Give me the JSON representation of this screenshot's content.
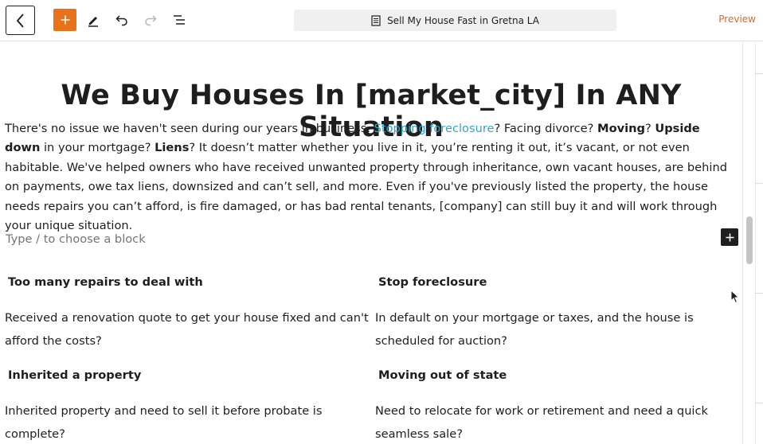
{
  "toolbar": {
    "document_title": "Sell My House Fast in Gretna LA",
    "preview_label": "Preview"
  },
  "content": {
    "heading": "We Buy Houses In [market_city] In ANY Situation",
    "intro": {
      "part1": "There's no issue we haven't seen during our years in business. ",
      "link": "Stopping foreclosure",
      "part2": "? Facing divorce? ",
      "bold1": "Moving",
      "part3": "? ",
      "bold2": "Upside down",
      "part4": " in your mortgage? ",
      "bold3": "Liens",
      "part5": "? It doesn’t matter whether you live in it, you’re renting it out, it’s vacant, or not even habitable. We've helped owners who have received unwanted property through inheritance, own vacant houses, are behind on payments, owe tax liens, downsized and can’t sell, and more. Even if you've previously listed the property, the house needs repairs you can’t afford, is fire damaged, or has bad rental tenants, [company] can still buy it and will work through your unique situation."
    },
    "block_placeholder": "Type / to choose a block",
    "situations": [
      {
        "title": "Too many repairs to deal with",
        "text": "Received a renovation quote to get your house fixed and can't afford the costs?"
      },
      {
        "title": "Stop foreclosure",
        "text": "In default on your mortgage or taxes, and the house is scheduled for auction?"
      },
      {
        "title": "Inherited a property",
        "text": "Inherited property and need to sell it before probate is complete?"
      },
      {
        "title": "Moving out of state",
        "text": "Need to relocate for work or retirement and need a quick seamless sale?"
      }
    ]
  },
  "colors": {
    "accent": "#e8711a",
    "link": "#2ea6c9",
    "preview": "#d8692a"
  },
  "icons": [
    "chevron-left-icon",
    "plus-icon",
    "pencil-icon",
    "undo-icon",
    "redo-icon",
    "list-view-icon",
    "document-icon",
    "mouse-cursor-icon"
  ]
}
